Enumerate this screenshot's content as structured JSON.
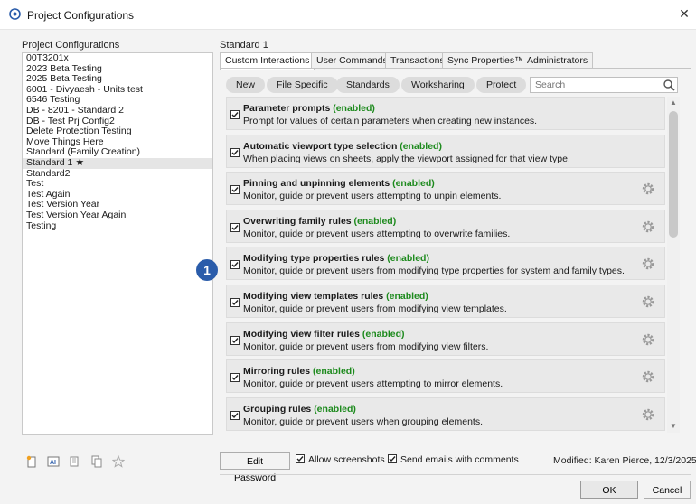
{
  "window": {
    "title": "Project Configurations"
  },
  "left_panel": {
    "label": "Project Configurations",
    "items": [
      "00T3201x",
      "2023 Beta Testing",
      "2025 Beta Testing",
      "6001 - Divyaesh - Units test",
      "6546 Testing",
      "DB - 8201 - Standard 2",
      "DB - Test Prj Config2",
      "Delete Protection Testing",
      "Move Things Here",
      "Standard (Family Creation)",
      "Standard 1",
      "Standard2",
      "Test",
      "Test Again",
      "Test Version Year",
      "Test Version Year Again",
      "Testing"
    ],
    "selected_index": 10
  },
  "right_panel": {
    "label": "Standard 1",
    "tabs": [
      "Custom Interactions",
      "User Commands",
      "Transactions",
      "Sync Properties™",
      "Administrators"
    ],
    "active_tab": 0,
    "filters": [
      "New",
      "File Specific",
      "Standards",
      "Worksharing",
      "Protect"
    ],
    "search": {
      "placeholder": "Search",
      "value": ""
    },
    "rules": [
      {
        "title": "Parameter prompts",
        "status": "(enabled)",
        "desc": "Prompt for values of certain parameters when creating new instances.",
        "gear": false
      },
      {
        "title": "Automatic viewport type selection",
        "status": "(enabled)",
        "desc": "When placing views on sheets, apply the viewport assigned for that view type.",
        "gear": false
      },
      {
        "title": "Pinning and unpinning elements",
        "status": "(enabled)",
        "desc": "Monitor, guide or prevent users attempting to unpin elements.",
        "gear": true
      },
      {
        "title": "Overwriting family rules",
        "status": "(enabled)",
        "desc": "Monitor, guide or prevent users attempting to overwrite families.",
        "gear": true
      },
      {
        "title": "Modifying type properties rules",
        "status": "(enabled)",
        "desc": "Monitor, guide or prevent users from modifying type properties for system and family types.",
        "gear": true
      },
      {
        "title": "Modifying view templates rules",
        "status": "(enabled)",
        "desc": "Monitor, guide or prevent users from modifying view templates.",
        "gear": true
      },
      {
        "title": "Modifying view filter rules",
        "status": "(enabled)",
        "desc": "Monitor, guide or prevent users from modifying view filters.",
        "gear": true
      },
      {
        "title": "Mirroring rules",
        "status": "(enabled)",
        "desc": "Monitor, guide or prevent users attempting to mirror elements.",
        "gear": true
      },
      {
        "title": "Grouping rules",
        "status": "(enabled)",
        "desc": "Monitor, guide or prevent users when grouping elements.",
        "gear": true
      }
    ]
  },
  "callout_number": "1",
  "footer": {
    "edit_password": "Edit Password",
    "allow_screenshots": "Allow screenshots",
    "send_emails": "Send emails with comments",
    "modified": "Modified: Karen Pierce, 12/3/2025",
    "ok": "OK",
    "cancel": "Cancel"
  },
  "colors": {
    "enabled_green": "#1d8a1d",
    "callout_blue": "#2a5caa"
  }
}
